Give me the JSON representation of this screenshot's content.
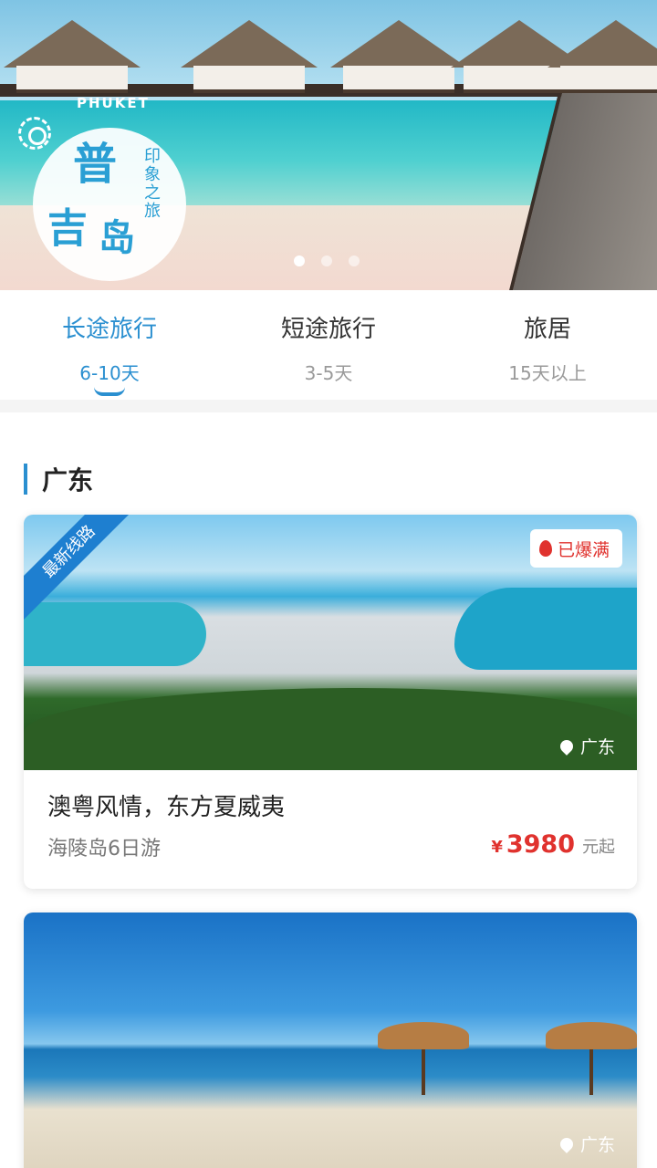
{
  "banner": {
    "phuket_label": "PHUKET",
    "logo_char1": "普",
    "logo_char2": "吉",
    "logo_char3": "岛",
    "logo_vertical": "印象之旅",
    "dots_count": 3,
    "active_dot": 0
  },
  "tabs": [
    {
      "title": "长途旅行",
      "sub": "6-10天",
      "active": true
    },
    {
      "title": "短途旅行",
      "sub": "3-5天",
      "active": false
    },
    {
      "title": "旅居",
      "sub": "15天以上",
      "active": false
    }
  ],
  "section": {
    "title": "广东"
  },
  "cards": [
    {
      "ribbon": "最新线路",
      "status": "已爆满",
      "location": "广东",
      "title": "澳粤风情，东方夏威夷",
      "subtitle": "海陵岛6日游",
      "price_symbol": "¥",
      "price": "3980",
      "price_unit": "元起"
    },
    {
      "location": "广东"
    }
  ],
  "colors": {
    "accent": "#2a8fd0",
    "price": "#e0322e"
  }
}
